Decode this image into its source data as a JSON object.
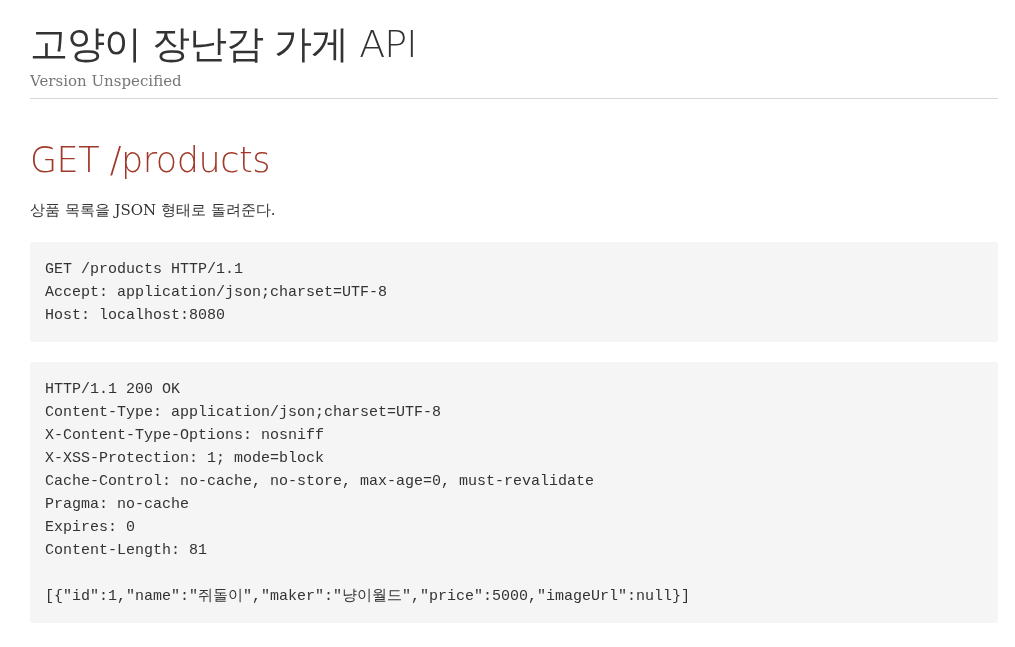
{
  "header": {
    "title": "고양이 장난감 가게 API",
    "version": "Version Unspecified"
  },
  "endpoint": {
    "heading": "GET /products",
    "description": "상품 목록을 JSON 형태로 돌려준다.",
    "request": {
      "lines": [
        "GET /products HTTP/1.1",
        "Accept: application/json;charset=UTF-8",
        "Host: localhost:8080"
      ]
    },
    "response": {
      "headers": [
        "HTTP/1.1 200 OK",
        "Content-Type: application/json;charset=UTF-8",
        "X-Content-Type-Options: nosniff",
        "X-XSS-Protection: 1; mode=block",
        "Cache-Control: no-cache, no-store, max-age=0, must-revalidate",
        "Pragma: no-cache",
        "Expires: 0",
        "Content-Length: 81"
      ],
      "body": "[{\"id\":1,\"name\":\"쥐돌이\",\"maker\":\"냥이월드\",\"price\":5000,\"imageUrl\":null}]"
    }
  }
}
